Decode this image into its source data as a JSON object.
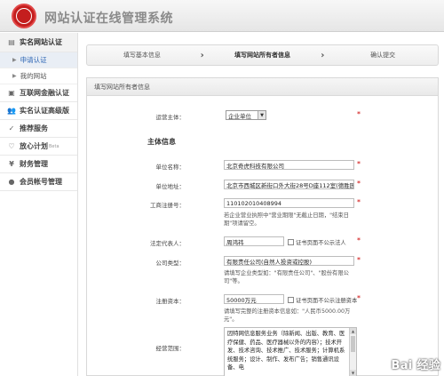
{
  "header": {
    "title": "网站认证在线管理系统",
    "logo_text": "认证联盟"
  },
  "sidebar": {
    "items": [
      {
        "label": "实名网站认证",
        "icon": "document-icon"
      },
      {
        "label": "申请认证",
        "sub": true
      },
      {
        "label": "我的网站",
        "sub": true
      },
      {
        "label": "互联网金融认证",
        "icon": "coin-icon"
      },
      {
        "label": "实名认证高级版",
        "icon": "people-icon"
      },
      {
        "label": "推荐服务",
        "icon": "thumbs-up-icon"
      },
      {
        "label": "放心计划",
        "icon": "heart-icon",
        "badge": "Beta"
      },
      {
        "label": "财务管理",
        "icon": "yen-icon"
      },
      {
        "label": "会员帐号管理",
        "icon": "user-icon"
      }
    ]
  },
  "steps": [
    "填写基本信息",
    "填写网站所有者信息",
    "确认提交"
  ],
  "panel": {
    "title": "填写网站所有者信息"
  },
  "form": {
    "owner_type_label": "运营主体：",
    "owner_type_value": "企业单位",
    "section_title": "主体信息",
    "company_name_label": "单位名称：",
    "company_name_value": "北京奇虎科技有限公司",
    "company_address_label": "单位地址：",
    "company_address_value": "北京市西城区新街口外大街28号D座112室(德胜园区)",
    "reg_no_label": "工商注册号：",
    "reg_no_value": "110102010408994",
    "reg_no_hint": "若企业营业执照中\"营业期限\"无截止日期，\"结束日期\"项请留空。",
    "legal_rep_label": "法定代表人：",
    "legal_rep_value": "周鸿祎",
    "legal_rep_checkbox": "证书页面不公示法人",
    "company_type_label": "公司类型：",
    "company_type_value": "有限责任公司(自然人投资或控股)",
    "company_type_hint": "请填写企业类型如：\"有限责任公司\"、\"股份有限公司\"等。",
    "capital_label": "注册资本：",
    "capital_value": "50000万元",
    "capital_checkbox": "证书页面不公示注册资本",
    "capital_hint": "请填写完整的注册资本信息如：\"人民币5000.00万元\"。",
    "scope_label": "经营范围：",
    "scope_value": "因特网信息服务业务（除新闻、出版、教育、医疗保健、药品、医疗器械以外的内容）；技术开发、技术咨询、技术推广、技术服务；计算机系统服务；设计、制作、发布广告；销售通讯设备、电"
  },
  "watermark": {
    "text": "Bai 经验"
  }
}
